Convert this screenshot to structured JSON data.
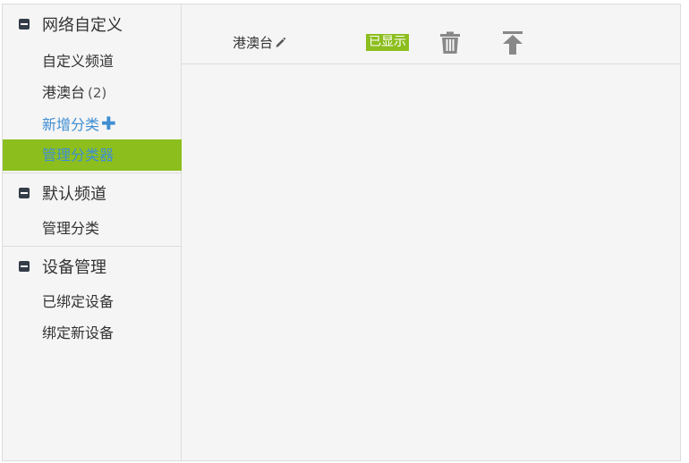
{
  "sidebar": {
    "sections": [
      {
        "title": "网络自定义",
        "items": [
          {
            "label": "自定义频道"
          },
          {
            "label": "港澳台",
            "count": "(2)"
          },
          {
            "label": "新增分类",
            "plus": "✚"
          },
          {
            "label": "管理分类器"
          }
        ]
      },
      {
        "title": "默认频道",
        "items": [
          {
            "label": "管理分类"
          }
        ]
      },
      {
        "title": "设备管理",
        "items": [
          {
            "label": "已绑定设备"
          },
          {
            "label": "绑定新设备"
          }
        ]
      }
    ]
  },
  "main": {
    "rows": [
      {
        "name": "港澳台",
        "status": "已显示"
      }
    ]
  },
  "colors": {
    "accent_green": "#8cbe1e",
    "link_blue": "#3f8ed3",
    "icon_gray": "#888888"
  }
}
